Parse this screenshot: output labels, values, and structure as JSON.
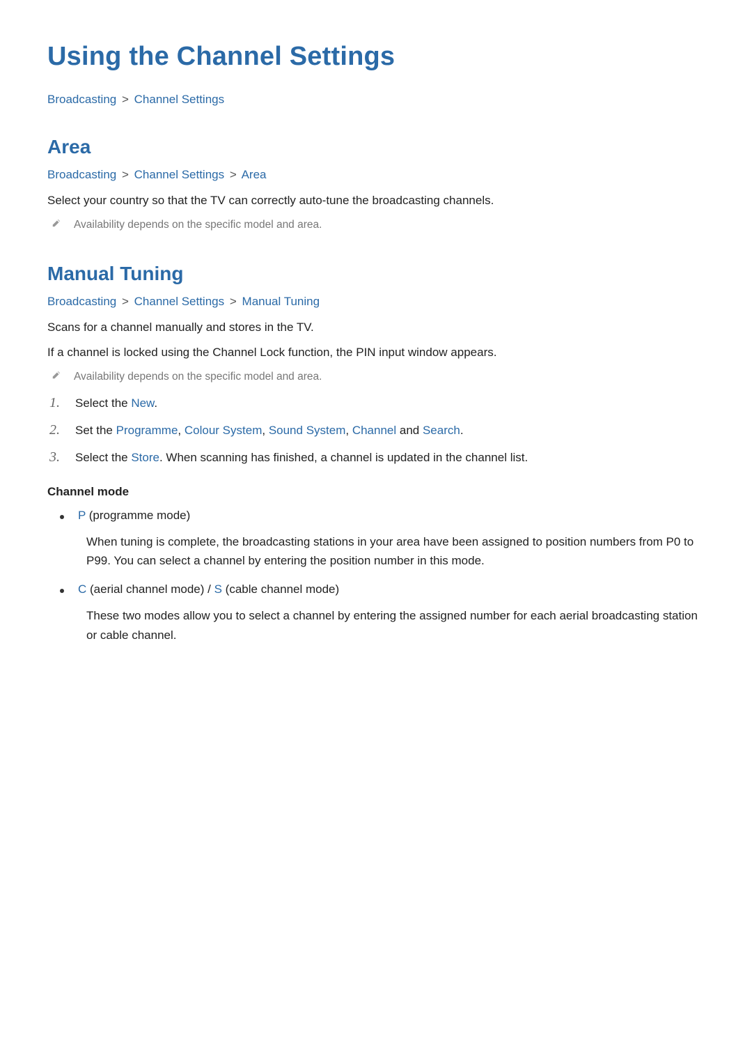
{
  "title": "Using the Channel Settings",
  "breadcrumb_main": {
    "items": [
      "Broadcasting",
      "Channel Settings"
    ],
    "sep": ">"
  },
  "section_area": {
    "heading": "Area",
    "breadcrumb": {
      "items": [
        "Broadcasting",
        "Channel Settings",
        "Area"
      ],
      "sep": ">"
    },
    "body": "Select your country so that the TV can correctly auto-tune the broadcasting channels.",
    "note": "Availability depends on the specific model and area."
  },
  "section_manual": {
    "heading": "Manual Tuning",
    "breadcrumb": {
      "items": [
        "Broadcasting",
        "Channel Settings",
        "Manual Tuning"
      ],
      "sep": ">"
    },
    "body1": "Scans for a channel manually and stores in the TV.",
    "body2": "If a channel is locked using the Channel Lock function, the PIN input window appears.",
    "note": "Availability depends on the specific model and area.",
    "steps": [
      {
        "num": "1.",
        "pre": "Select the ",
        "kw1": "New",
        "post": "."
      },
      {
        "num": "2.",
        "pre": "Set the ",
        "kw_list": [
          "Programme",
          "Colour System",
          "Sound System",
          "Channel"
        ],
        "kw_sep": ", ",
        "kw_and": " and ",
        "kw_last": "Search",
        "post": "."
      },
      {
        "num": "3.",
        "pre": "Select the ",
        "kw1": "Store",
        "post": ". When scanning has finished, a channel is updated in the channel list."
      }
    ],
    "channel_mode": {
      "heading": "Channel mode",
      "items": [
        {
          "code1": "P",
          "label1": " (programme mode)",
          "desc": "When tuning is complete, the broadcasting stations in your area have been assigned to position numbers from P0 to P99. You can select a channel by entering the position number in this mode."
        },
        {
          "code1": "C",
          "label1": " (aerial channel mode) / ",
          "code2": "S",
          "label2": " (cable channel mode)",
          "desc": "These two modes allow you to select a channel by entering the assigned number for each aerial broadcasting station or cable channel."
        }
      ]
    }
  }
}
